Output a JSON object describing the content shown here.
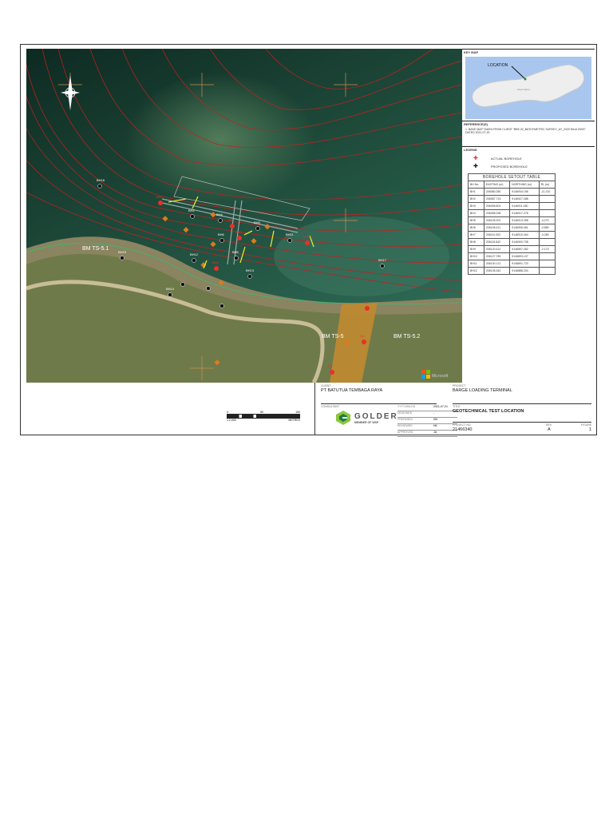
{
  "map": {
    "benchmarks": [
      "BM TS-5.1",
      "BM TS-5",
      "BM TS-5.2"
    ],
    "actual_boreholes": [
      "BH1",
      "BH7",
      "BH3",
      "BH8",
      "BH10",
      "CG",
      "CK",
      "CF"
    ],
    "proposed_boreholes": [
      "BH2",
      "BH4",
      "BH5",
      "BH6",
      "BH9",
      "BH11",
      "BH12",
      "BH13",
      "BH14",
      "BH15",
      "BH16",
      "BH17"
    ],
    "watermark": "Microsoft"
  },
  "scale_bar": {
    "ticks": [
      "0",
      "50",
      "100"
    ],
    "ratio": "1:2,000",
    "unit": "METRES"
  },
  "key_map": {
    "heading": "KEY MAP",
    "location_label": "LOCATION",
    "places": [
      "Kisar Island"
    ]
  },
  "references": {
    "heading": "REFERENCE(S)",
    "text": "1. BASE MAP TAKEN FROM CLIENT \"BBS 02_BATHYMETRIC SURVEY_AY_2020 Rev0.DWG\" DATED 2021-07-20"
  },
  "legend": {
    "heading": "LEGEND",
    "items": [
      {
        "label": "ACTUAL BOREHOLE",
        "color": "#e8302a"
      },
      {
        "label": "PROPOSED BOREHOLE",
        "color": "#111111"
      }
    ]
  },
  "setout_table": {
    "title": "BOREHOLE SETOUT TABLE",
    "headers": [
      "BH No.",
      "EASTING (m)",
      "NORTHING (m)",
      "RL (m)"
    ],
    "rows": [
      [
        "BH1",
        "206080.280",
        "9146934.156",
        "-11.210"
      ],
      [
        "BH2",
        "206087.713",
        "9146927.288",
        ""
      ],
      [
        "BH3",
        "206095.801",
        "9146911.450",
        ""
      ],
      [
        "BH4",
        "206098.298",
        "9146917.278",
        ""
      ],
      [
        "BH5",
        "206105.301",
        "9146913.258",
        "-4.270"
      ],
      [
        "BH6",
        "206108.411",
        "9146908.461",
        "-3.850"
      ],
      [
        "BH7",
        "206110.302",
        "9146910.264",
        "-3.280"
      ],
      [
        "BH8",
        "206115.842",
        "9146900.738",
        ""
      ],
      [
        "BH9",
        "206120.412",
        "9146897.282",
        "-2.170"
      ],
      [
        "BH10",
        "206127.783",
        "9146893.107",
        ""
      ],
      [
        "BH11",
        "206130.121",
        "9146891.723",
        ""
      ],
      [
        "BH12",
        "206135.342",
        "9146888.204",
        ""
      ]
    ]
  },
  "title_block": {
    "client_label": "CLIENT",
    "client": "PT BATUTUA TEMBAGA RAYA",
    "project_label": "PROJECT",
    "project": "BARGE LOADING TERMINAL",
    "consultant_label": "CONSULTANT",
    "logo": "GOLDER",
    "logo_sub": "MEMBER OF WSP",
    "fields": [
      {
        "label": "YYYY-MM-DD",
        "value": "2021-07-21"
      },
      {
        "label": "DESIGNED",
        "value": "-"
      },
      {
        "label": "PREPARED",
        "value": "DN"
      },
      {
        "label": "REVIEWED",
        "value": "HK"
      },
      {
        "label": "APPROVED",
        "value": "JA"
      }
    ],
    "title_label": "TITLE",
    "title": "GEOTECHNICAL TEST LOCATION",
    "project_no_label": "PROJECT NO.",
    "project_no": "21466340",
    "rev_label": "REV.",
    "rev": "A",
    "figure_label": "FIGURE",
    "figure": "1"
  }
}
